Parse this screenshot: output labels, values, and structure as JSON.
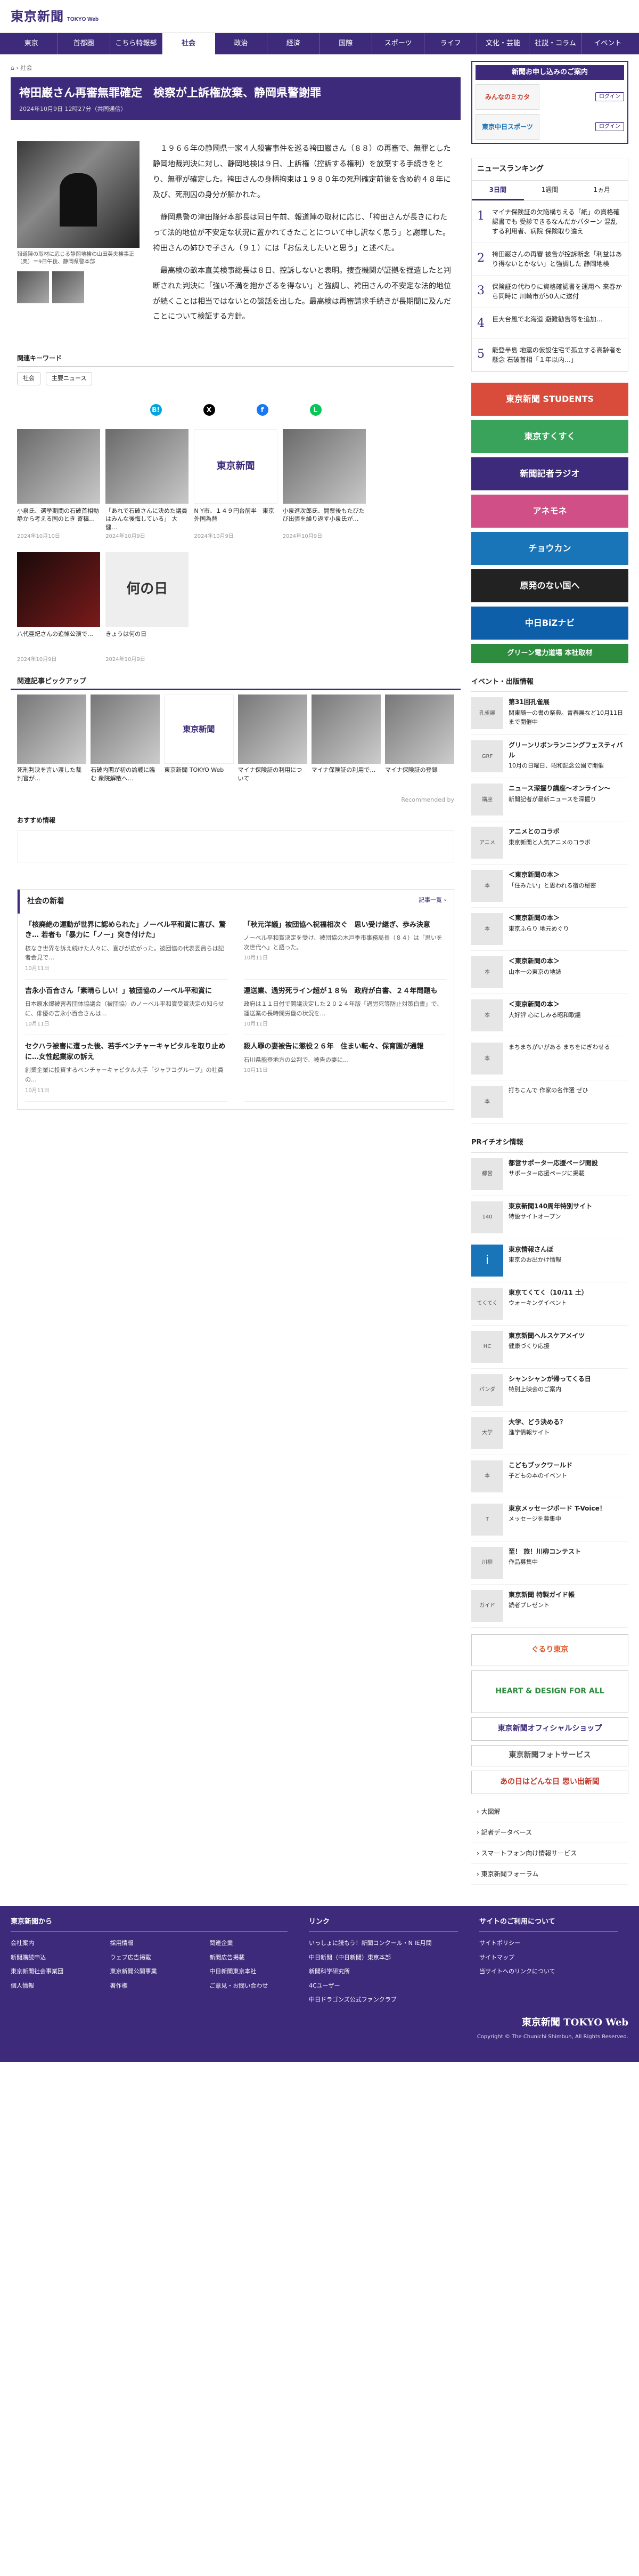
{
  "header": {
    "logo": "東京新聞",
    "logo_sub": "TOKYO Web"
  },
  "nav": [
    "東京",
    "首都圏",
    "こちら特報部",
    "社会",
    "政治",
    "経済",
    "国際",
    "スポーツ",
    "ライフ",
    "文化・芸能",
    "社説・コラム",
    "イベント"
  ],
  "breadcrumb": [
    "⌂",
    "社会"
  ],
  "article": {
    "title": "袴田巌さん再審無罪確定　検察が上訴権放棄、静岡県警謝罪",
    "date": "2024年10月9日 12時27分（共同通信）",
    "caption": "報道陣の取材に応じる静岡地検の山田英夫検事正（奥）＝9日午後、静岡県警本部",
    "paragraphs": [
      "１９６６年の静岡県一家４人殺害事件を巡る袴田巌さん（８８）の再審で、無罪とした静岡地裁判決に対し、静岡地検は９日、上訴権（控訴する権利）を放棄する手続きをとり、無罪が確定した。袴田さんの身柄拘束は１９８０年の死刑確定前後を含め約４８年に及び、死刑囚の身分が解かれた。",
      "静岡県警の津田隆好本部長は同日午前、報道陣の取材に応じ、「袴田さんが長きにわたって法的地位が不安定な状況に置かれてきたことについて申し訳なく思う」と謝罪した。袴田さんの姉ひで子さん（９１）には「お伝えしたいと思う」と述べた。",
      "最高検の畝本直美検事総長は８日、控訴しないと表明。捜査機関が証拠を捏造したと判断された判決に「強い不満を抱かざるを得ない」と強調し、袴田さんの不安定な法的地位が続くことは相当ではないとの談話を出した。最高検は再審請求手続きが長期間に及んだことについて検証する方針。"
    ]
  },
  "keywords": {
    "title": "関連キーワード",
    "tags": [
      "社会",
      "主要ニュース"
    ]
  },
  "share": [
    {
      "icon": "hatena-icon",
      "label": "B!",
      "color": "#00a4de"
    },
    {
      "icon": "x-icon",
      "label": "X",
      "color": "#000000"
    },
    {
      "icon": "facebook-icon",
      "label": "f",
      "color": "#1877f2"
    },
    {
      "icon": "line-icon",
      "label": "L",
      "color": "#06c755"
    }
  ],
  "related": [
    {
      "title": "小泉氏、選挙期間の石破首相動静から考える国のとき 寄稿…",
      "date": "2024年10月10日"
    },
    {
      "title": "「あれで石破さんに決めた議員はみんな後悔している」 大健…",
      "date": "2024年10月9日"
    },
    {
      "title": "N Y市、１４９円台前半　東京外国為替",
      "date": "2024年10月9日"
    },
    {
      "title": "小泉進次郎氏、開票後もたびたび出張を繰り返す小泉氏が…",
      "date": "2024年10月9日"
    },
    {
      "title": "八代亜紀さんの追悼公演で…",
      "date": "2024年10月9日"
    },
    {
      "title": "きょうは何の日",
      "date": "2024年10月9日"
    }
  ],
  "pickup": {
    "title": "関連記事ピックアップ",
    "items": [
      "死刑判決を言い渡した裁判官が…",
      "石破内閣が初の論戦に臨む 衆院解散へ…",
      "東京新聞 TOKYO Web",
      "マイナ保険証の利用について",
      "マイナ保険証の利用で…",
      "マイナ保険証の登録"
    ],
    "rec": "Recommended by"
  },
  "osusume": "おすすめ情報",
  "social": {
    "title": "社会の新着",
    "more": "記事一覧 ›",
    "items": [
      {
        "h": "「核廃絶の運動が世界に認められた」ノーベル平和賞に喜び、驚き… 若者も「暴力に「ノー」突き付けた」",
        "x": "核なき世界を訴え続けた人々に、喜びが広がった。被団協の代表委員らは記者会見で…",
        "d": "10月11日"
      },
      {
        "h": "「秋元洋議」被団協へ祝福相次ぐ　思い受け継ぎ、歩み決意",
        "x": "ノーベル平和賞決定を受け、被団協の木戸季市事務局長（８４）は「思いを次世代へ」と語った。",
        "d": "10月11日"
      },
      {
        "h": "吉永小百合さん「素晴らしい！」被団協のノーベル平和賞に",
        "x": "日本原水爆被害者団体協議会（被団協）のノーベル平和賞受賞決定の知らせに、俳優の吉永小百合さんは…",
        "d": "10月11日"
      },
      {
        "h": "運送業、過労死ライン超が１８％　政府が白書、２４年問題も",
        "x": "政府は１１日付で閣議決定した２０２４年版「過労死等防止対策白書」で、運送業の長時間労働の状況を…",
        "d": "10月11日"
      },
      {
        "h": "セクハラ被害に遭った後、若手ベンチャーキャピタルを取り止めに…女性起業家の訴え",
        "x": "創業企業に投資するベンチャーキャピタル大手「ジャフコグループ」の社員の…",
        "d": "10月11日"
      },
      {
        "h": "殺人罪の妻被告に懲役２６年　住まい転々、保育園が通報",
        "x": "石川県能登地方の公判で、被告の妻に…",
        "d": "10月11日"
      }
    ]
  },
  "sidebar": {
    "sub": {
      "title": "新聞お申し込みのご案内",
      "rows": [
        {
          "logo": "みんなのミカタ",
          "btn": "ログイン"
        },
        {
          "logo": "東京中日スポーツ",
          "btn": "ログイン"
        }
      ]
    },
    "ranking": {
      "title": "ニュースランキング",
      "tabs": [
        "3日間",
        "1週間",
        "1ヵ月"
      ],
      "items": [
        "マイナ保険証の欠陥構ちえる「紙」の資格確認書でも 受診できるなんだかパターン 混乱する利用者、病院 保険取り違え",
        "袴田巌さんの再審 被告が控訴断念「利益はあり得ないとかない」と強調した 静岡地検",
        "保険証の代わりに資格確認書を運用へ 来春から同時に 川崎市が50人に送付",
        "巨大台風で北海道 避難勧告等を追加…",
        "能登半島 地震の仮設住宅で孤立する高齢者を懸念 石破首相「１年以内…」"
      ]
    },
    "banners": [
      {
        "t": "東京新聞 STUDENTS",
        "c": "#d94c3b"
      },
      {
        "t": "東京すくすく",
        "c": "#3aa35b"
      },
      {
        "t": "新聞記者ラジオ",
        "c": "#3d2a7a"
      },
      {
        "t": "アネモネ",
        "c": "#d04f87"
      },
      {
        "t": "チョウカン",
        "c": "#1a74b8"
      },
      {
        "t": "原発のない国へ",
        "c": "#222222"
      },
      {
        "t": "中日BiZナビ",
        "c": "#0c5fa8"
      },
      {
        "t": "グリーン電力道場 本社取材",
        "c": "#2e8c3e"
      }
    ],
    "events_title": "イベント・出版情報",
    "events": [
      {
        "b": "第31回孔雀展",
        "x": "関東随一の書の祭典。青春展など10月11日まで開催中",
        "i": "孔雀展"
      },
      {
        "b": "グリーンリボンランニングフェスティバル",
        "x": "10月の日曜日、昭和記念公園で開催",
        "i": "GRF"
      },
      {
        "b": "ニュース深掘り講座〜オンライン〜",
        "x": "新聞記者が最新ニュースを深掘り",
        "i": "講座"
      },
      {
        "b": "アニメとのコラボ",
        "x": "東京新聞と人気アニメのコラボ",
        "i": "アニメ"
      },
      {
        "b": "＜東京新聞の本＞",
        "x": "「住みたい」と思われる宿の秘密",
        "i": "本"
      },
      {
        "b": "＜東京新聞の本＞",
        "x": "東京ふらり 地元めぐり",
        "i": "本"
      },
      {
        "b": "＜東京新聞の本＞",
        "x": "山本一の東京の地誌",
        "i": "本"
      },
      {
        "b": "＜東京新聞の本＞",
        "x": "大好評 心にしみる昭和歌謡",
        "i": "本"
      },
      {
        "b": "",
        "x": "まちまちがいがある まちをにぎわせる",
        "i": "本"
      },
      {
        "b": "",
        "x": "打ちこんで 作家の名作選 ぜひ",
        "i": "本"
      }
    ],
    "pr_title": "PRイチオシ情報",
    "pr": [
      {
        "b": "都営サポーター応援ページ開設",
        "x": "サポーター応援ページに掲載",
        "i": "都営"
      },
      {
        "b": "東京新聞140周年特別サイト",
        "x": "特設サイトオープン",
        "i": "140"
      },
      {
        "b": "東京情報さんぽ",
        "x": "東京のお出かけ情報",
        "i": "i"
      },
      {
        "b": "東京てくてく（10/11 土）",
        "x": "ウォーキングイベント",
        "i": "てくてく"
      },
      {
        "b": "東京新聞ヘルスケアメイツ",
        "x": "健康づくり応援",
        "i": "HC"
      },
      {
        "b": "シャンシャンが帰ってくる日",
        "x": "特別上映会のご案内",
        "i": "パンダ"
      },
      {
        "b": "大学、どう決める？",
        "x": "進学情報サイト",
        "i": "大学"
      },
      {
        "b": "こどもブックワールド",
        "x": "子どもの本のイベント",
        "i": "本"
      },
      {
        "b": "東京メッセージボード T-Voice！",
        "x": "メッセージを募集中",
        "i": "T"
      },
      {
        "b": "至！ 旅！川柳コンテスト",
        "x": "作品募集中",
        "i": "川柳"
      },
      {
        "b": "東京新聞 特製ガイド帳",
        "x": "読者プレゼント",
        "i": "ガイド"
      }
    ],
    "bottom_banners": [
      {
        "t": "ぐるり東京",
        "c": "#e05a2b"
      },
      {
        "t": "HEART & DESIGN FOR ALL",
        "c": "#2e8c3e"
      },
      {
        "t": "東京新聞オフィシャルショップ",
        "c": "#3d2a7a"
      },
      {
        "t": "東京新聞フォトサービス",
        "c": "#555555"
      },
      {
        "t": "あの日はどんな日 思い出新聞",
        "c": "#c0392b"
      }
    ],
    "links": [
      "› 大図解",
      "› 記者データベース",
      "› スマートフォン向け情報サービス",
      "› 東京新聞フォーラム"
    ]
  },
  "footer": {
    "cols": [
      {
        "h": "東京新聞から",
        "items": [
          "会社案内",
          "採用情報",
          "関連企業",
          "新聞購読申込",
          "ウェブ広告掲載",
          "新聞広告掲載",
          "東京新聞社会事業団",
          "東京新聞公開事業",
          "中日新聞東京本社",
          "個人情報",
          "著作権",
          "ご意見・お問い合わせ"
        ]
      },
      {
        "h": "リンク",
        "items": [
          "いっしょに読もう！新聞コンクール・N IE月間",
          "中日新聞（中日新聞）東京本部",
          "新聞科学研究所",
          "4Cユーザー",
          "中日ドラゴンズ公式ファンクラブ"
        ]
      },
      {
        "h": "サイトのご利用について",
        "items": [
          "サイトポリシー",
          "サイトマップ",
          "当サイトへのリンクについて"
        ]
      }
    ],
    "logo": "東京新聞 TOKYO Web",
    "copy": "Copyright © The Chunichi Shimbun, All Rights Reserved."
  }
}
